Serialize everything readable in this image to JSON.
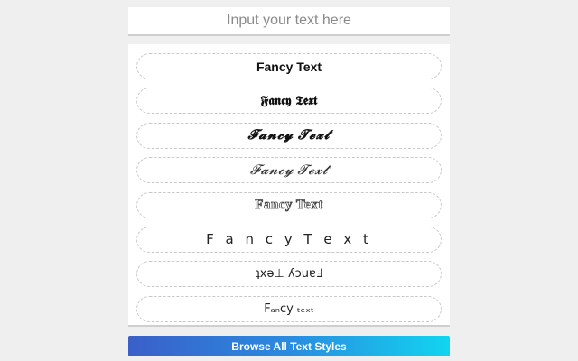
{
  "input": {
    "placeholder": "Input your text here",
    "value": ""
  },
  "styles": [
    {
      "text": "Fancy Text"
    },
    {
      "text": "𝕱𝖆𝖓𝖈𝖞 𝕿𝖊𝖝𝖙"
    },
    {
      "text": "𝓕𝓪𝓷𝓬𝔂 𝓣𝓮𝔁𝓽"
    },
    {
      "text": "𝓕𝓪𝓷𝓬𝔂 𝓣𝓮𝔁𝓽"
    },
    {
      "text": "Fancy Text"
    },
    {
      "text": "F a n c y  T e x t"
    },
    {
      "text": "ʇxǝ⊥ ʎɔuɐℲ"
    },
    {
      "text": "Fₐₙcy ₜₑₓₜ"
    }
  ],
  "browse_button": {
    "label": "Browse All Text Styles"
  },
  "colors": {
    "background": "#efefef",
    "button_gradient_start": "#3a5fc8",
    "button_gradient_end": "#12d4f0"
  }
}
